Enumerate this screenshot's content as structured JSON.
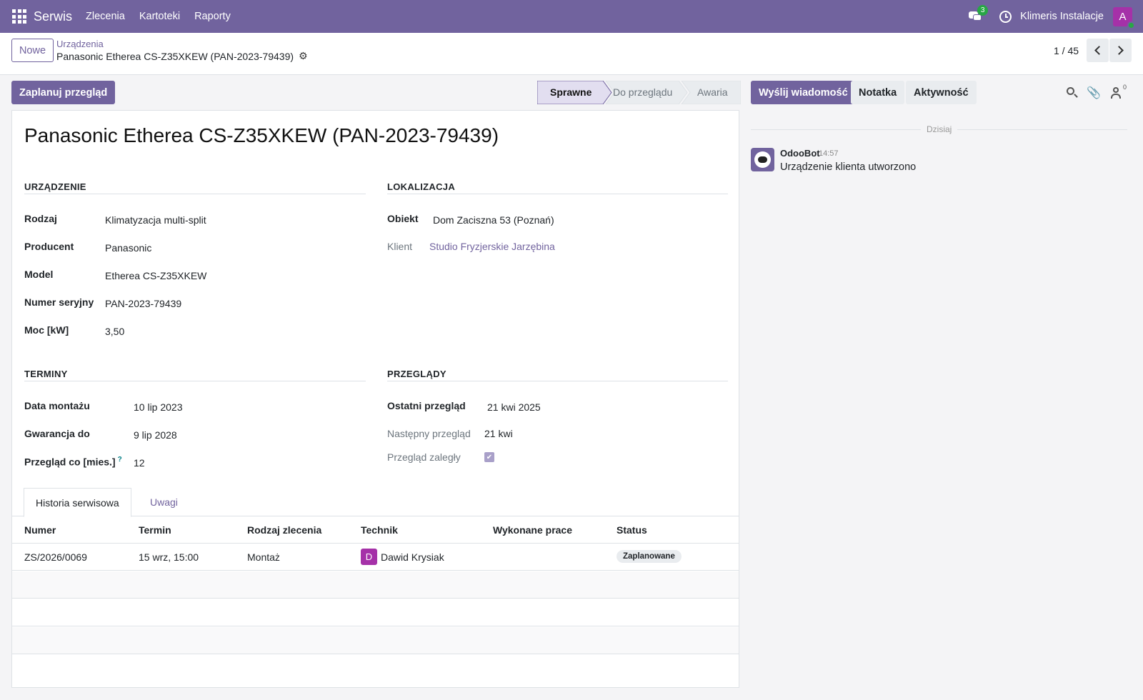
{
  "navbar": {
    "app_name": "Serwis",
    "menu": [
      "Zlecenia",
      "Kartoteki",
      "Raporty"
    ],
    "messages_count": "3",
    "company": "Klimeris Instalacje",
    "user_initial": "A"
  },
  "control": {
    "new_label": "Nowe",
    "breadcrumb_parent": "Urządzenia",
    "breadcrumb_current": "Panasonic Etherea CS-Z35XKEW (PAN-2023-79439)",
    "pager": "1 / 45"
  },
  "actions": {
    "schedule_label": "Zaplanuj przegląd",
    "stages": [
      "Sprawne",
      "Do przeglądu",
      "Awaria"
    ],
    "active_stage": "Sprawne"
  },
  "form": {
    "title": "Panasonic Etherea CS-Z35XKEW (PAN-2023-79439)",
    "device": {
      "section": "URZĄDZENIE",
      "rodzaj_label": "Rodzaj",
      "rodzaj": "Klimatyzacja multi-split",
      "producent_label": "Producent",
      "producent": "Panasonic",
      "model_label": "Model",
      "model": "Etherea CS-Z35XKEW",
      "serial_label": "Numer seryjny",
      "serial": "PAN-2023-79439",
      "power_label": "Moc [kW]",
      "power": "3,50"
    },
    "location": {
      "section": "LOKALIZACJA",
      "object_label": "Obiekt",
      "object": "Dom Zaciszna 53 (Poznań)",
      "client_label": "Klient",
      "client": "Studio Fryzjerskie Jarzębina"
    },
    "terms": {
      "section": "TERMINY",
      "install_label": "Data montażu",
      "install": "10 lip 2023",
      "warranty_label": "Gwarancja do",
      "warranty": "9 lip 2028",
      "interval_label": "Przegląd co [mies.]",
      "interval_help": "?",
      "interval": "12"
    },
    "reviews": {
      "section": "PRZEGLĄDY",
      "last_label": "Ostatni przegląd",
      "last": "21 kwi 2025",
      "next_label": "Następny przegląd",
      "next": "21 kwi",
      "overdue_label": "Przegląd zaległy",
      "overdue": true
    },
    "tabs": [
      "Historia serwisowa",
      "Uwagi"
    ],
    "table": {
      "headers": [
        "Numer",
        "Termin",
        "Rodzaj zlecenia",
        "Technik",
        "Wykonane prace",
        "Status"
      ],
      "rows": [
        {
          "numer": "ZS/2026/0069",
          "termin": "15 wrz, 15:00",
          "rodzaj": "Montaż",
          "technik_initial": "D",
          "technik": "Dawid Krysiak",
          "prace": "",
          "status": "Zaplanowane"
        }
      ]
    }
  },
  "chatter": {
    "send_label": "Wyślij wiadomość",
    "note_label": "Notatka",
    "activity_label": "Aktywność",
    "followers_count": "0",
    "date_separator": "Dzisiaj",
    "message": {
      "author": "OdooBot",
      "time": "14:57",
      "body": "Urządzenie klienta utworzono"
    }
  }
}
